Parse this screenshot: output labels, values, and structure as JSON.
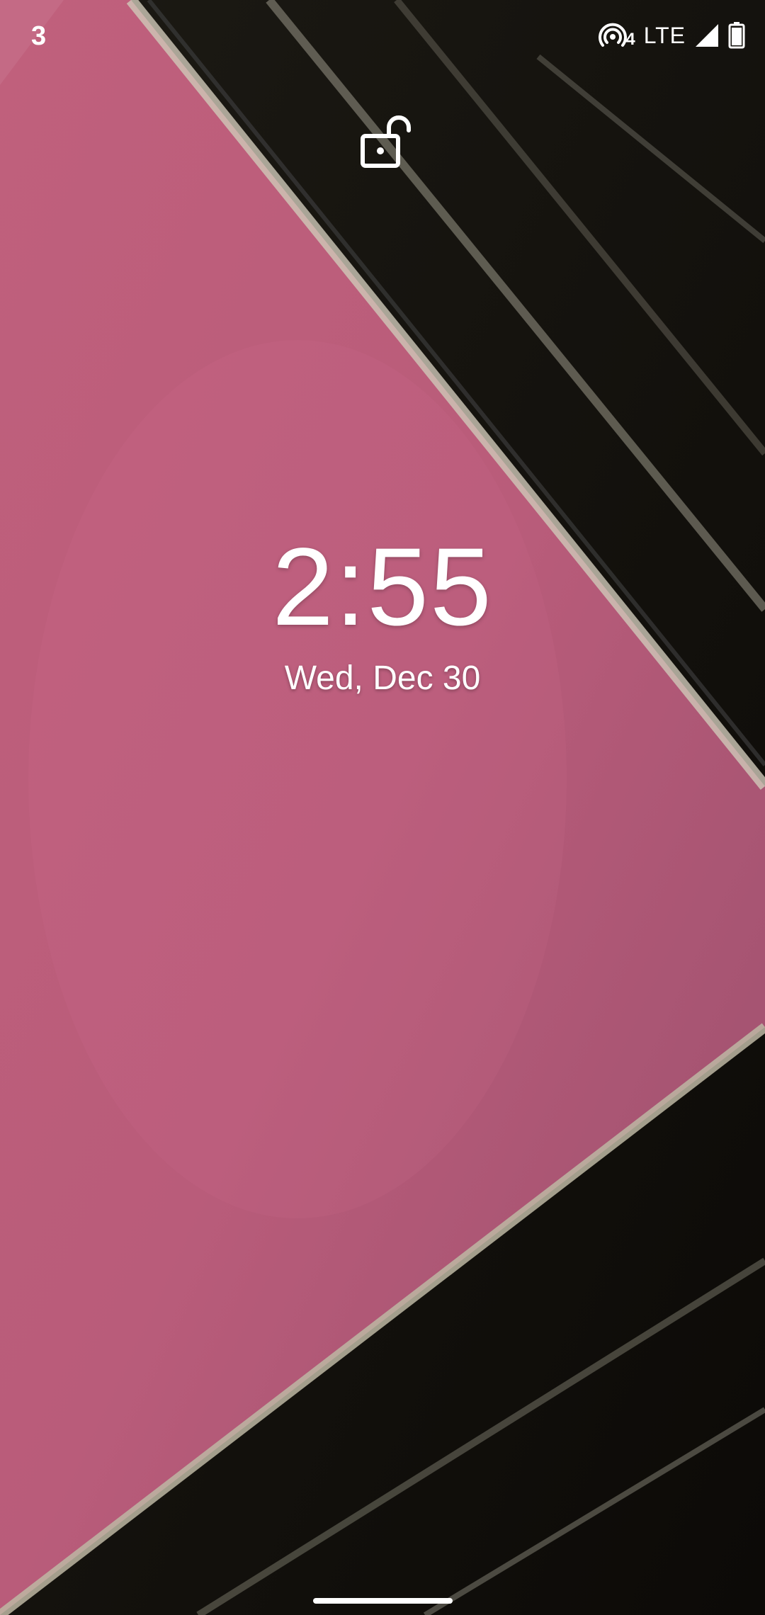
{
  "status_bar": {
    "notification_count": "3",
    "hotspot_count": "4",
    "network_label": "LTE",
    "icons": [
      "hotspot-icon",
      "signal-icon",
      "battery-icon"
    ]
  },
  "lockscreen": {
    "lock_icon": "unlocked-padlock-icon",
    "time": "2:55",
    "date": "Wed, Dec 30"
  },
  "colors": {
    "wallpaper_pink": "#c25f7c",
    "wallpaper_dark": "#15120d",
    "text": "#ffffff"
  }
}
